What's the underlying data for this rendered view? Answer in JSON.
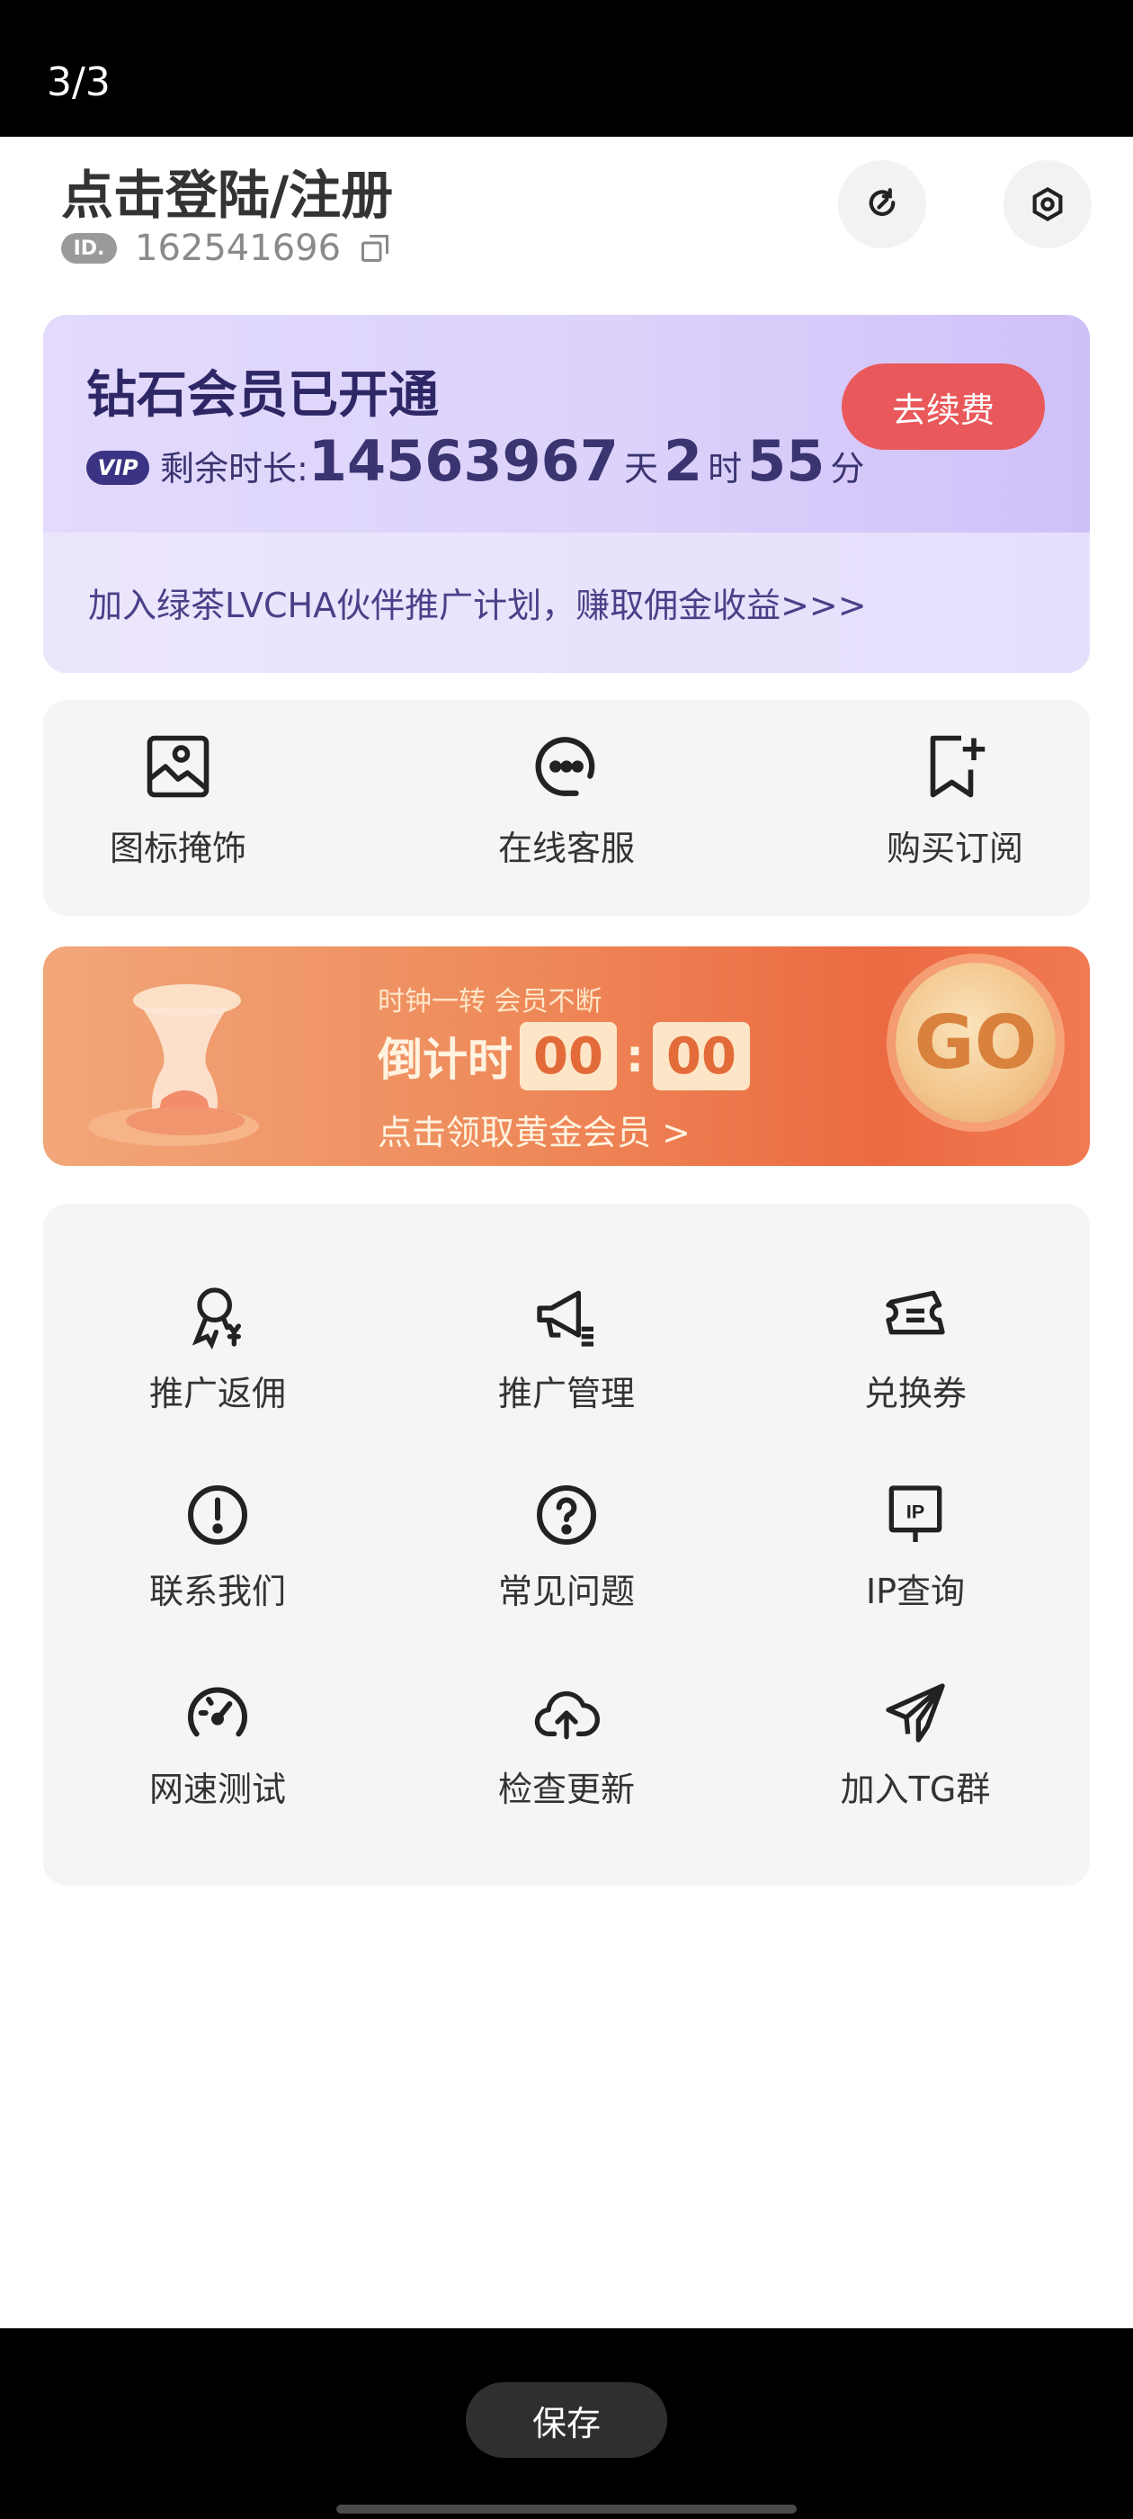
{
  "viewer": {
    "counter": "3/3",
    "save_label": "保存"
  },
  "header": {
    "login_title": "点击登陆/注册",
    "id_badge": "ID.",
    "id_value": "162541696",
    "refresh_icon": "refresh-icon",
    "settings_icon": "settings-icon"
  },
  "vip": {
    "title": "钻石会员已开通",
    "badge": "VIP",
    "remaining_label": "剩余时长:",
    "days": "14563967",
    "day_unit": "天",
    "hours": "2",
    "hour_unit": "时",
    "minutes": "55",
    "minute_unit": "分",
    "renew_label": "去续费",
    "partner_text": "加入绿茶LVCHA伙伴推广计划，赚取佣金收益>>>"
  },
  "quick_actions": [
    {
      "label": "图标掩饰",
      "icon": "image-icon"
    },
    {
      "label": "在线客服",
      "icon": "chat-icon"
    },
    {
      "label": "购买订阅",
      "icon": "bookmark-add-icon"
    }
  ],
  "promo": {
    "subtitle": "时钟一转 会员不断",
    "countdown_label": "倒计时",
    "minutes": "00",
    "separator": ":",
    "seconds": "00",
    "link_text": "点击领取黄金会员 >",
    "go_label": "GO"
  },
  "grid": [
    {
      "label": "推广返佣",
      "icon": "commission-icon"
    },
    {
      "label": "推广管理",
      "icon": "megaphone-icon"
    },
    {
      "label": "兑换券",
      "icon": "ticket-icon"
    },
    {
      "label": "联系我们",
      "icon": "alert-icon"
    },
    {
      "label": "常见问题",
      "icon": "help-icon"
    },
    {
      "label": "IP查询",
      "icon": "ip-icon"
    },
    {
      "label": "网速测试",
      "icon": "speedometer-icon"
    },
    {
      "label": "检查更新",
      "icon": "cloud-upload-icon"
    },
    {
      "label": "加入TG群",
      "icon": "telegram-icon"
    }
  ],
  "colors": {
    "accent_red": "#e9585a",
    "vip_purple": "#3b3383",
    "promo_orange": "#ec6a42"
  }
}
